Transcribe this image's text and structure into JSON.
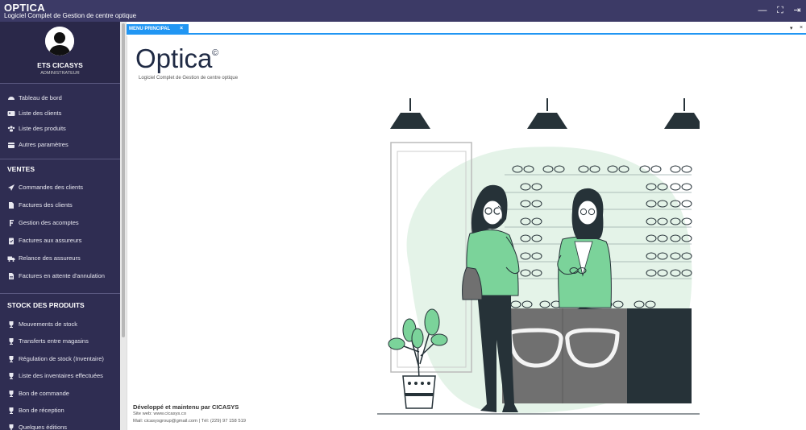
{
  "app": {
    "title": "OPTICA",
    "subtitle": "Logiciel Complet de Gestion de centre optique"
  },
  "user": {
    "name": "ETS CICASYS",
    "role": "ADMINISTRATEUR"
  },
  "nav_main": [
    {
      "label": "Tableau de bord",
      "icon": "dashboard-icon"
    },
    {
      "label": "Liste des clients",
      "icon": "address-card-icon"
    },
    {
      "label": "Liste des produits",
      "icon": "users-icon"
    },
    {
      "label": "Autres paramètres",
      "icon": "calendar-icon"
    }
  ],
  "sections": {
    "ventes": "VENTES",
    "stock": "STOCK DES PRODUITS"
  },
  "nav_ventes": [
    {
      "label": "Commandes des clients",
      "icon": "send-icon"
    },
    {
      "label": "Factures des clients",
      "icon": "file-icon"
    },
    {
      "label": "Gestion des acomptes",
      "icon": "franc-icon"
    },
    {
      "label": "Factures aux assureurs",
      "icon": "clipboard-check-icon"
    },
    {
      "label": "Relance des assureurs",
      "icon": "truck-icon"
    },
    {
      "label": "Factures en attente d'annulation",
      "icon": "file-text-icon"
    }
  ],
  "nav_stock": [
    {
      "label": "Mouvements de stock",
      "icon": "trophy-icon"
    },
    {
      "label": "Transferts entre magasins",
      "icon": "trophy-icon"
    },
    {
      "label": "Régulation de stock (Inventaire)",
      "icon": "trophy-icon"
    },
    {
      "label": "Liste des inventaires effectuées",
      "icon": "trophy-icon"
    },
    {
      "label": "Bon de commande",
      "icon": "trophy-icon"
    },
    {
      "label": "Bon de réception",
      "icon": "trophy-icon"
    },
    {
      "label": "Quelques éditions",
      "icon": "trophy-icon"
    }
  ],
  "tab": {
    "label": "MENU PRINCIPAL",
    "close": "×"
  },
  "tab_controls": {
    "menu": "▾",
    "close": "×"
  },
  "window_controls": {
    "minimize": "—",
    "fullscreen": "⛶",
    "logout": "⇥"
  },
  "brand": {
    "name": "Optica",
    "copyright": "©",
    "tagline": "Logiciel Complet de Gestion de centre optique"
  },
  "footer": {
    "developed": "Développé et maintenu par CICASYS",
    "site": "Site web: www.cicasys.co",
    "contact": "Mail: cicasysgroup@gmail.com | Tél: (229) 97 158 519"
  },
  "colors": {
    "titlebar": "#3c3a66",
    "sidebar": "#2f2d52",
    "tab_accent": "#2196f3",
    "illustration_green": "#7bd39a",
    "illustration_dark": "#263238"
  }
}
